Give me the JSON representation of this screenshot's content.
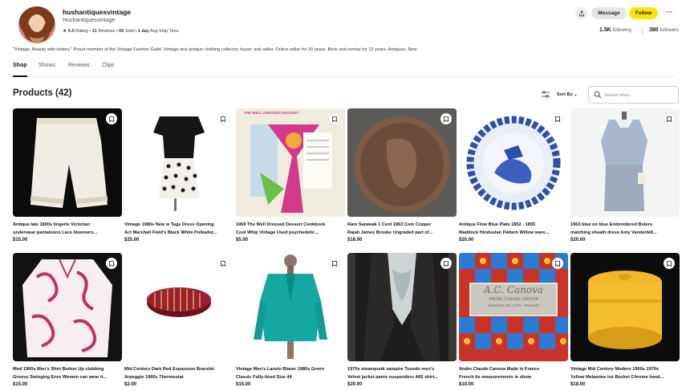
{
  "profile": {
    "username": "hushantiquesvintage",
    "handle": "Hushantiquesvintage",
    "rating": "5.0",
    "rating_label": "Rating",
    "reviews_count": "11",
    "reviews_label": "Reviews",
    "sold_count": "65",
    "sold_label": "Sold",
    "ship_time": "1 day",
    "ship_label": "Avg Ship Time",
    "following_count": "1.5K",
    "following_label": "following",
    "followers_count": "380",
    "followers_label": "followers",
    "bio": "\"Vintage, Beauty with history.\" Proud member of the Vintage Fashion Guild. Vintage and antique clothing collector, buyer, and seller. Online seller for 20 years. Brick and mortar for 12 years. Antiques. New."
  },
  "actions": {
    "message_label": "Message",
    "follow_label": "Follow",
    "more_label": "···"
  },
  "tabs": [
    {
      "label": "Shop"
    },
    {
      "label": "Shows"
    },
    {
      "label": "Reviews"
    },
    {
      "label": "Clips"
    }
  ],
  "products_header": {
    "title": "Products (42)",
    "sort_label": "Sort By",
    "search_placeholder": "Search shop..."
  },
  "colors": {
    "follow_button": "#ffe600",
    "text_primary": "#111111"
  },
  "products": [
    {
      "line1": "Antique late 1800s lingerie Victorian",
      "line2": "underwear pantaloons Lace bloomers...",
      "price": "$15.00"
    },
    {
      "line1": "Vintage 1980s New w Tags Dress Opening",
      "line2": "Act Marshall Field's Black White Polkadot...",
      "price": "$25.00"
    },
    {
      "line1": "1969 The Well Dressed Dessert Cookbook",
      "line2": "Cool Whip Vintage Used psychedelic...",
      "price": "$5.00"
    },
    {
      "line1": "Rare Sarawak 1 Cent 1863 Coin Copper",
      "line2": "Rajah James Brooke Ungraded part of...",
      "price": "$18.00"
    },
    {
      "line1": "Antique Flow Blue Plate 1852 - 1855",
      "line2": "Maddock Hindustan Pattern Willow ware...",
      "price": "$20.00"
    },
    {
      "line1": "1963 blue on blue Embroidered Bolero",
      "line2": "matching sheath dress Amy Vanderbilt...",
      "price": "$20.00"
    },
    {
      "line1": "Mod 1960s Men's Shirt Button Up clubbing",
      "line2": "Groovy Swinging Enro Women can wear it...",
      "price": "$15.00"
    },
    {
      "line1": "Mid Century Dark Red Expansion Bracelet",
      "line2": "Arpeggio 1960s Thermostat",
      "price": "$2.00"
    },
    {
      "line1": "Vintage Men's Lanvin Blazer 1980s Green",
      "line2": "Classic Fully-lined Size 44",
      "price": "$15.00"
    },
    {
      "line1": "1970s steampunk vampire Tuxedo men's",
      "line2": "Velvet jacket pants suspenders 44S shirt...",
      "price": "$20.00"
    },
    {
      "line1": "Andre Claude Canova Made in France",
      "line2": "French tie measurements in show",
      "price": "$10.00"
    },
    {
      "line1": "Vintage Mid Century Modern 1960s 1970s",
      "line2": "Yellow Melamine Ice Bucket Chrome hand...",
      "price": "$18.00"
    }
  ],
  "image_text": {
    "cookbook_cover": "THE WELL DRESSED DESSERT",
    "tie_label_name": "A.C. Canova",
    "tie_label_sub": "ANDRE CLAUDE CANOVA",
    "tie_label_loc": "SOIERIES DE LYON · FRANCE"
  }
}
